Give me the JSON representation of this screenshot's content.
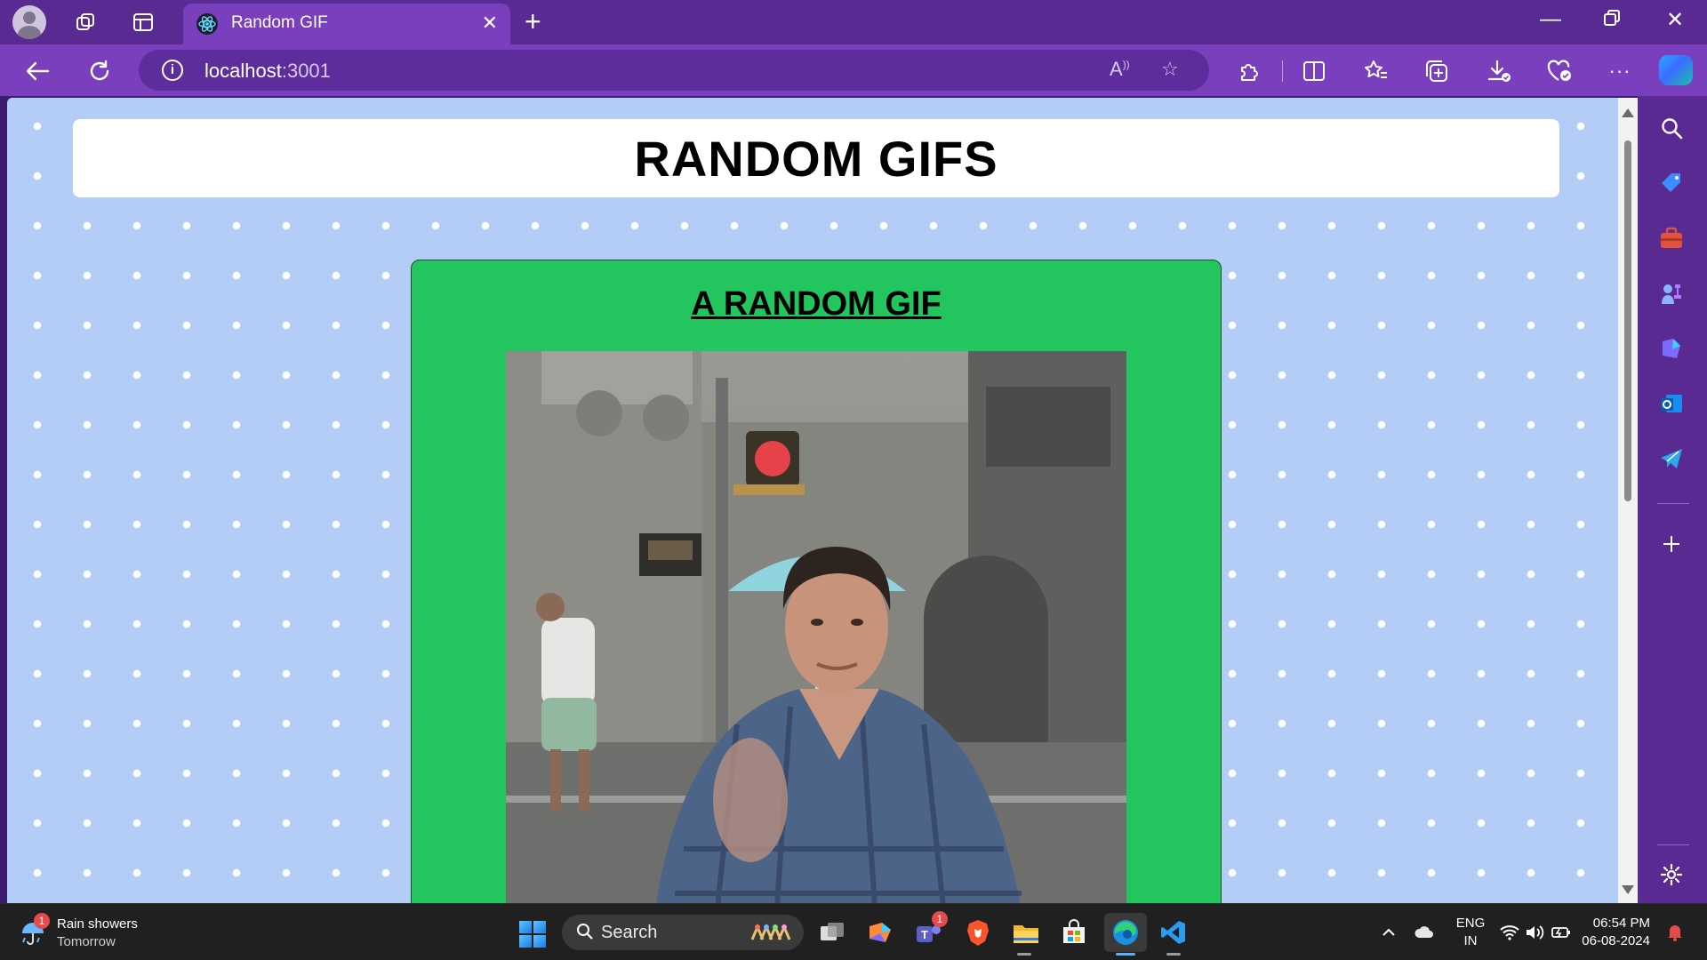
{
  "browser": {
    "tab_title": "Random GIF",
    "url_host": "localhost",
    "url_port": ":3001"
  },
  "page": {
    "header_title": "RANDOM GIFS",
    "card_title": "A RANDOM GIF"
  },
  "taskbar": {
    "weather_text": "Rain showers",
    "weather_sub": "Tomorrow",
    "weather_badge": "1",
    "search_label": "Search",
    "teams_badge": "1",
    "lang_line1": "ENG",
    "lang_line2": "IN",
    "time": "06:54 PM",
    "date": "06-08-2024"
  },
  "colors": {
    "tab_strip": "#5a2a93",
    "toolbar": "#7a3fbd",
    "page_background": "#b3cdf6",
    "card_green": "#22c55e"
  }
}
